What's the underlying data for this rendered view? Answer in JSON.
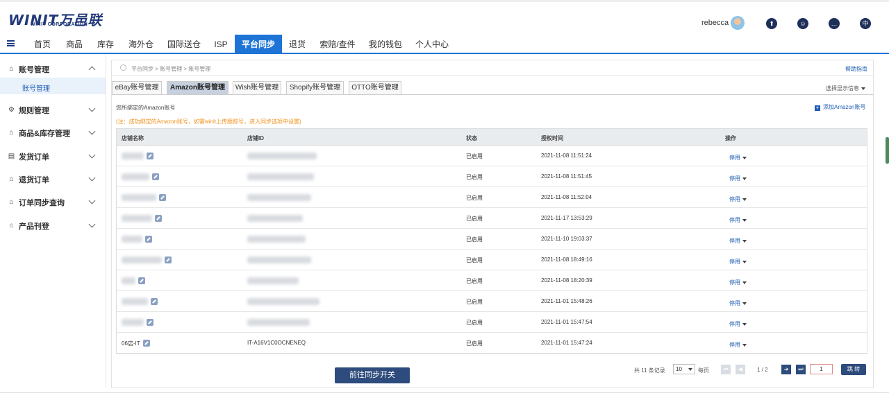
{
  "header": {
    "logo_main": "WINIT万邑联",
    "logo_sub": "WINIT CORPORATION",
    "username": "rebecca",
    "icons": [
      "upload-icon",
      "support-icon",
      "message-icon",
      "language-icon"
    ],
    "language_glyph": "中"
  },
  "nav": {
    "items": [
      "首页",
      "商品",
      "库存",
      "海外仓",
      "国际送仓",
      "ISP",
      "平台同步",
      "退货",
      "索赔/查件",
      "我的钱包",
      "个人中心"
    ],
    "active": "平台同步"
  },
  "sidebar": {
    "items": [
      {
        "label": "账号管理",
        "expanded": true
      },
      {
        "label": "规则管理"
      },
      {
        "label": "商品&库存管理"
      },
      {
        "label": "发货订单"
      },
      {
        "label": "退货订单"
      },
      {
        "label": "订单同步查询"
      },
      {
        "label": "产品刊登"
      }
    ],
    "sub_item": "账号管理"
  },
  "main": {
    "breadcrumb": "平台同步 > 账号管理 > 账号管理",
    "help": "帮助指南",
    "tabs": [
      "eBay账号管理",
      "Amazon账号管理",
      "Wish账号管理",
      "Shopify账号管理",
      "OTTO账号管理"
    ],
    "active_tab": "Amazon账号管理",
    "display_select": "选择显示信息",
    "section_title": "您所绑定的Amazon账号",
    "note": "(注：成功绑定的Amazon账号，如需winit上传跟踪号，进入同步选项中设置)",
    "add_link": "添加Amazon账号",
    "columns": [
      "店铺名称",
      "店铺ID",
      "状态",
      "授权时间",
      "操作"
    ],
    "rows": [
      {
        "name": "",
        "id": "",
        "status": "已启用",
        "time": "2021-11-08 11:51:24",
        "op": "停用"
      },
      {
        "name": "",
        "id": "",
        "status": "已启用",
        "time": "2021-11-08 11:51:45",
        "op": "停用"
      },
      {
        "name": "",
        "id": "",
        "status": "已启用",
        "time": "2021-11-08 11:52:04",
        "op": "停用"
      },
      {
        "name": "",
        "id": "",
        "status": "已启用",
        "time": "2021-11-17 13:53:29",
        "op": "停用"
      },
      {
        "name": "",
        "id": "",
        "status": "已启用",
        "time": "2021-11-10 19:03:37",
        "op": "停用"
      },
      {
        "name": "",
        "id": "",
        "status": "已启用",
        "time": "2021-11-08 18:49:16",
        "op": "停用"
      },
      {
        "name": "",
        "id": "",
        "status": "已启用",
        "time": "2021-11-08 18:20:39",
        "op": "停用"
      },
      {
        "name": "",
        "id": "",
        "status": "已启用",
        "time": "2021-11-01 15:48:26",
        "op": "停用"
      },
      {
        "name": "",
        "id": "",
        "status": "已启用",
        "time": "2021-11-01 15:47:54",
        "op": "停用"
      },
      {
        "name": "06店-IT",
        "id": "IT-A16V1C0OCNENEQ",
        "status": "已启用",
        "time": "2021-11-01 15:47:24",
        "op": "停用"
      }
    ],
    "sync_button": "前往同步开关",
    "pagination": {
      "total": "共 11 条记录",
      "page_size": "10",
      "per_page": "每页",
      "page_info": "1 / 2",
      "page_input": "1",
      "jump": "跳 转"
    }
  }
}
